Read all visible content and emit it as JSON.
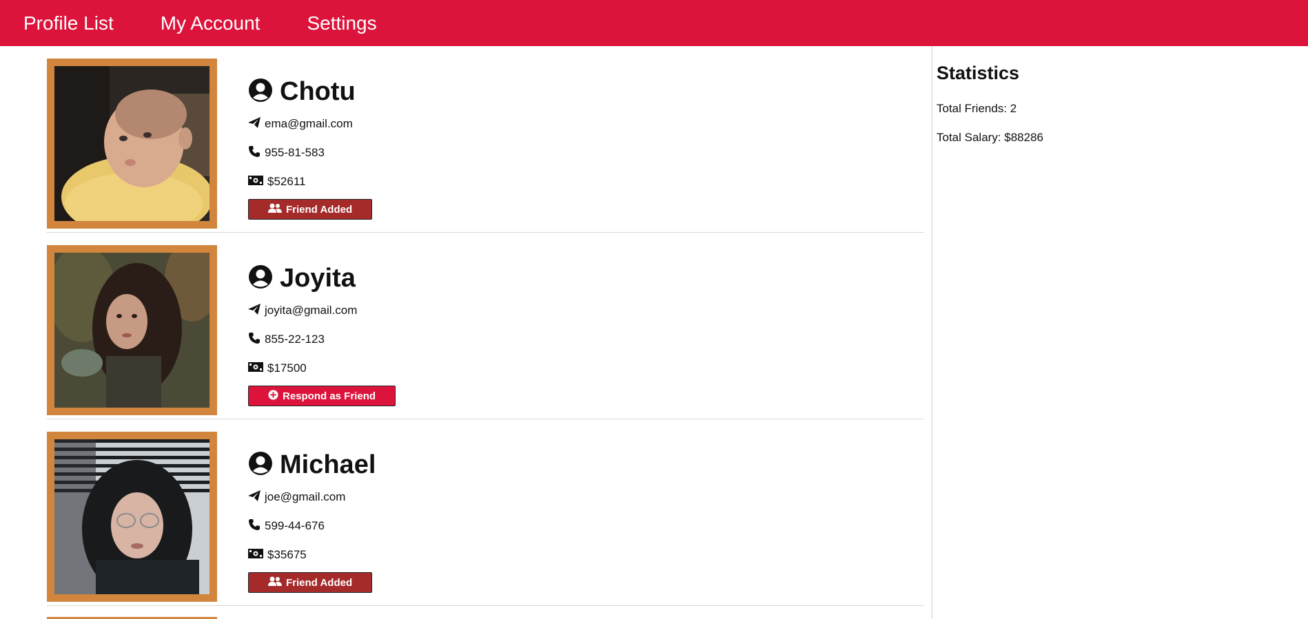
{
  "nav": {
    "items": [
      "Profile List",
      "My Account",
      "Settings"
    ]
  },
  "colors": {
    "topbar": "#DC143C",
    "frame": "#D2853C",
    "friend_added_button": "#A52A2A",
    "respond_button": "#DC143C"
  },
  "profiles": [
    {
      "name": "Chotu",
      "email": "ema@gmail.com",
      "phone": "955-81-583",
      "salary": "$52611",
      "button": "Friend Added",
      "button_icon": "user-friends-icon",
      "status": "added"
    },
    {
      "name": "Joyita",
      "email": "joyita@gmail.com",
      "phone": "855-22-123",
      "salary": "$17500",
      "button": "Respond as Friend",
      "button_icon": "plus-circle-icon",
      "status": "pending"
    },
    {
      "name": "Michael",
      "email": "joe@gmail.com",
      "phone": "599-44-676",
      "salary": "$35675",
      "button": "Friend Added",
      "button_icon": "user-friends-icon",
      "status": "added"
    }
  ],
  "stats": {
    "title": "Statistics",
    "total_friends": "Total Friends: 2",
    "total_salary": "Total Salary: $88286"
  }
}
